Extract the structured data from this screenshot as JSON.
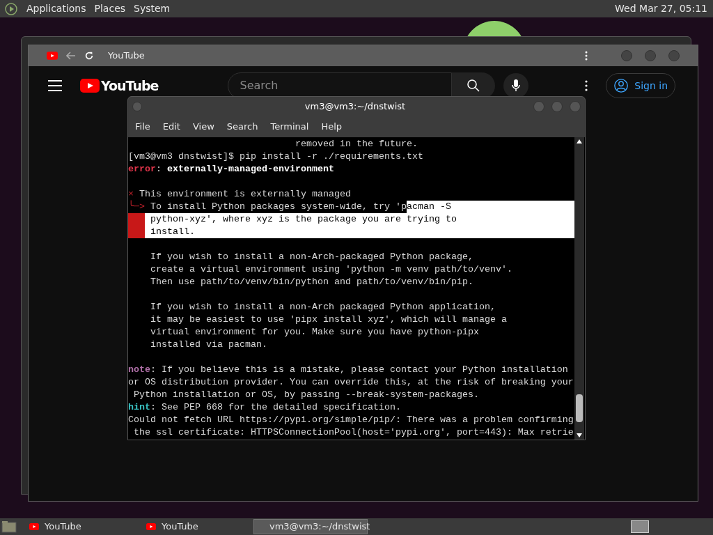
{
  "top_panel": {
    "menus": [
      "Applications",
      "Places",
      "System"
    ],
    "clock": "Wed Mar 27, 05:11"
  },
  "browser": {
    "tab_title": "YouTube",
    "logo": "YouTube",
    "search_placeholder": "Search",
    "sign_in": "Sign in"
  },
  "terminal": {
    "title": "vm3@vm3:~/dnstwist",
    "menu": [
      "File",
      "Edit",
      "View",
      "Search",
      "Terminal",
      "Help"
    ],
    "lines": [
      {
        "kind": "text",
        "segments": [
          {
            "text": "                              removed in the future.",
            "kind": "plain"
          }
        ]
      },
      {
        "kind": "text",
        "segments": [
          {
            "text": "[vm3@vm3 dnstwist]$ pip install -r ./requirements.txt",
            "kind": "plain"
          }
        ]
      },
      {
        "kind": "text",
        "segments": [
          {
            "text": "error",
            "kind": "error"
          },
          {
            "text": ": ",
            "kind": "plain"
          },
          {
            "text": "externally-managed-environment",
            "kind": "bold"
          }
        ]
      },
      {
        "kind": "blank"
      },
      {
        "kind": "text",
        "segments": [
          {
            "text": "×",
            "kind": "marker"
          },
          {
            "text": " This environment is externally managed",
            "kind": "plain"
          }
        ]
      },
      {
        "kind": "text",
        "segments": [
          {
            "text": "╰─>",
            "kind": "marker"
          },
          {
            "text": " To install Python packages system-wide, try 'p",
            "kind": "plain"
          },
          {
            "text": "acman -S",
            "kind": "selected"
          }
        ]
      },
      {
        "kind": "text",
        "gutter_selected": true,
        "segments": [
          {
            "text": "python-xyz', where xyz is the package you are trying to",
            "kind": "selected"
          }
        ]
      },
      {
        "kind": "text",
        "gutter_selected": true,
        "segments": [
          {
            "text": "install.",
            "kind": "selected"
          }
        ]
      },
      {
        "kind": "blank"
      },
      {
        "kind": "text",
        "segments": [
          {
            "text": "    If you wish to install a non-Arch-packaged Python package,",
            "kind": "plain"
          }
        ]
      },
      {
        "kind": "text",
        "segments": [
          {
            "text": "    create a virtual environment using 'python -m venv path/to/venv'.",
            "kind": "plain"
          }
        ]
      },
      {
        "kind": "text",
        "segments": [
          {
            "text": "    Then use path/to/venv/bin/python and path/to/venv/bin/pip.",
            "kind": "plain"
          }
        ]
      },
      {
        "kind": "blank"
      },
      {
        "kind": "text",
        "segments": [
          {
            "text": "    If you wish to install a non-Arch packaged Python application,",
            "kind": "plain"
          }
        ]
      },
      {
        "kind": "text",
        "segments": [
          {
            "text": "    it may be easiest to use 'pipx install xyz', which will manage a",
            "kind": "plain"
          }
        ]
      },
      {
        "kind": "text",
        "segments": [
          {
            "text": "    virtual environment for you. Make sure you have python-pipx",
            "kind": "plain"
          }
        ]
      },
      {
        "kind": "text",
        "segments": [
          {
            "text": "    installed via pacman.",
            "kind": "plain"
          }
        ]
      },
      {
        "kind": "blank"
      },
      {
        "kind": "text",
        "segments": [
          {
            "text": "note",
            "kind": "note"
          },
          {
            "text": ": If you believe this is a mistake, please contact your Python installation",
            "kind": "plain"
          }
        ]
      },
      {
        "kind": "text",
        "segments": [
          {
            "text": "or OS distribution provider. You can override this, at the risk of breaking your",
            "kind": "plain"
          }
        ]
      },
      {
        "kind": "text",
        "segments": [
          {
            "text": " Python installation or OS, by passing --break-system-packages.",
            "kind": "plain"
          }
        ]
      },
      {
        "kind": "text",
        "segments": [
          {
            "text": "hint",
            "kind": "hint"
          },
          {
            "text": ": See PEP 668 for the detailed specification.",
            "kind": "plain"
          }
        ]
      },
      {
        "kind": "text",
        "segments": [
          {
            "text": "Could not fetch URL https://pypi.org/simple/pip/: There was a problem confirming",
            "kind": "plain"
          }
        ]
      },
      {
        "kind": "text",
        "segments": [
          {
            "text": " the ssl certificate: HTTPSConnectionPool(host='pypi.org', port=443): Max retrie",
            "kind": "plain"
          }
        ]
      }
    ]
  },
  "taskbar": [
    {
      "label": "YouTube",
      "kind": "browser",
      "selected": false
    },
    {
      "label": "YouTube",
      "kind": "browser",
      "selected": false
    },
    {
      "label": "vm3@vm3:~/dnstwist",
      "kind": "terminal",
      "selected": true
    }
  ]
}
